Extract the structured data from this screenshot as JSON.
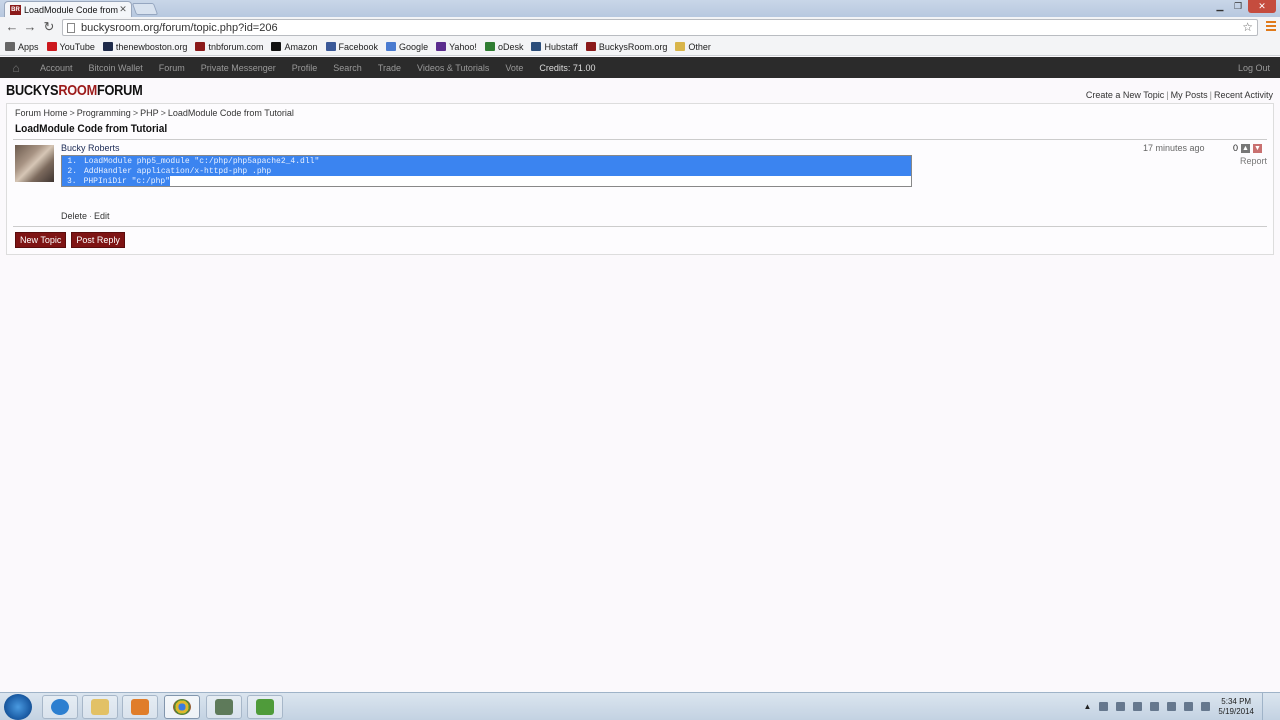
{
  "browser": {
    "tab_title": "LoadModule Code from T",
    "tab_favicon": "BR",
    "url": "buckysroom.org/forum/topic.php?id=206",
    "bookmarks": [
      {
        "label": "Apps",
        "icon": "apps-icon",
        "color": "#666666"
      },
      {
        "label": "YouTube",
        "icon": "youtube-icon",
        "color": "#cc181e"
      },
      {
        "label": "thenewboston.org",
        "icon": "thenewboston-icon",
        "color": "#1e2a4a"
      },
      {
        "label": "tnbforum.com",
        "icon": "tnbforum-icon",
        "color": "#8b1a1a"
      },
      {
        "label": "Amazon",
        "icon": "amazon-icon",
        "color": "#111111"
      },
      {
        "label": "Facebook",
        "icon": "facebook-icon",
        "color": "#3b5998"
      },
      {
        "label": "Google",
        "icon": "google-icon",
        "color": "#4a7bd0"
      },
      {
        "label": "Yahoo!",
        "icon": "yahoo-icon",
        "color": "#5b2d8e"
      },
      {
        "label": "oDesk",
        "icon": "odesk-icon",
        "color": "#2f7d32"
      },
      {
        "label": "Hubstaff",
        "icon": "hubstaff-icon",
        "color": "#2b4d7a"
      },
      {
        "label": "BuckysRoom.org",
        "icon": "buckysroom-icon",
        "color": "#8b1a1a"
      },
      {
        "label": "Other",
        "icon": "folder-icon",
        "color": "#d9b54a"
      }
    ]
  },
  "sitenav": {
    "items": [
      "Account",
      "Bitcoin Wallet",
      "Forum",
      "Private Messenger",
      "Profile",
      "Search",
      "Trade",
      "Videos & Tutorials",
      "Vote"
    ],
    "credits": "Credits: 71.00",
    "logout": "Log Out"
  },
  "header": {
    "logo_a": "BUCKYS",
    "logo_b": "ROOM",
    "logo_c": "FORUM",
    "links": [
      "Create a New Topic",
      "My Posts",
      "Recent Activity"
    ]
  },
  "breadcrumb": [
    "Forum Home",
    "Programming",
    "PHP",
    "LoadModule Code from Tutorial"
  ],
  "topic": {
    "title": "LoadModule Code from Tutorial",
    "post": {
      "author": "Bucky Roberts",
      "time": "17 minutes ago",
      "score": "0",
      "report": "Report",
      "code": [
        {
          "num": "1.",
          "text": "LoadModule php5_module \"c:/php/php5apache2_4.dll\""
        },
        {
          "num": "2.",
          "text": "AddHandler application/x-httpd-php .php"
        },
        {
          "num": "3.",
          "text": "PHPIniDir \"c:/php\""
        }
      ],
      "actions": [
        "Delete",
        "Edit"
      ]
    },
    "buttons": [
      "New Topic",
      "Post Reply"
    ]
  },
  "taskbar": {
    "time": "5:34 PM",
    "date": "5/19/2014"
  }
}
